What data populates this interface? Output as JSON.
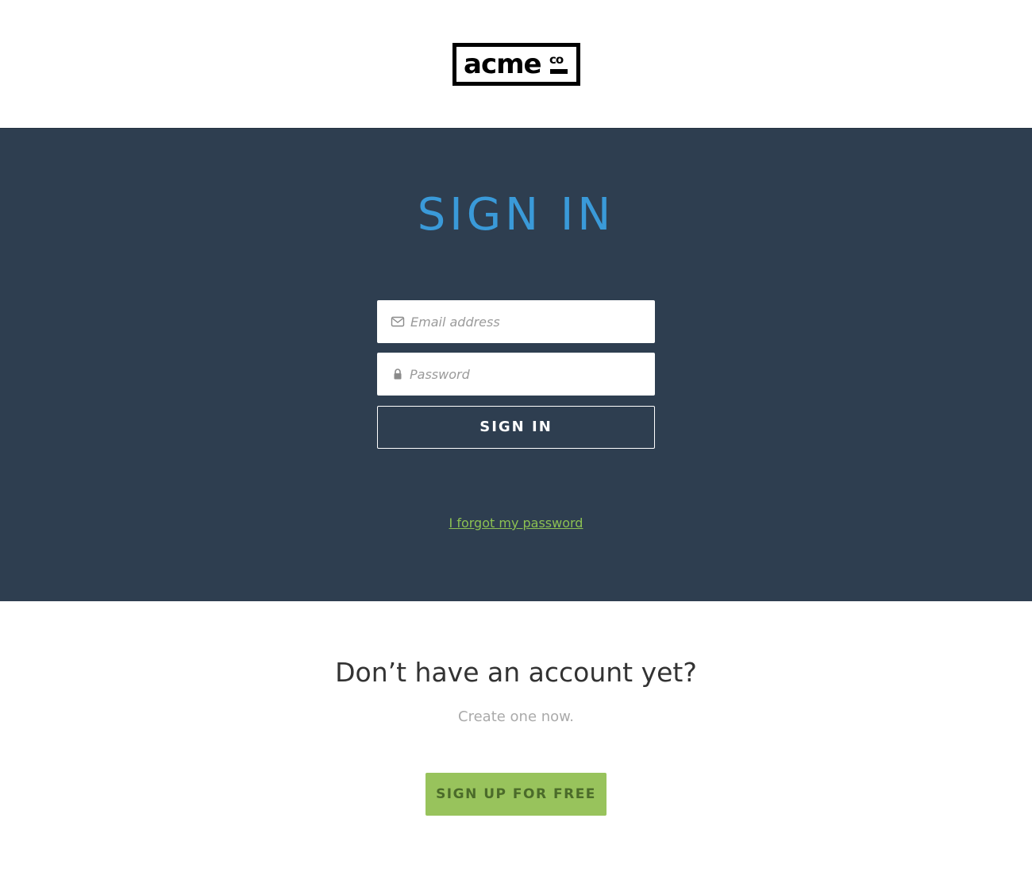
{
  "logo": {
    "main": "acme",
    "sub": "co"
  },
  "signin": {
    "title": "SIGN IN",
    "email_placeholder": "Email address",
    "password_placeholder": "Password",
    "button_label": "SIGN IN",
    "forgot_link": "I forgot my password"
  },
  "signup": {
    "title": "Don’t have an account yet?",
    "subtitle": "Create one now.",
    "button_label": "SIGN UP FOR FREE"
  },
  "icons": {
    "email": "envelope-icon",
    "password": "lock-icon"
  },
  "colors": {
    "panel_background": "#2e3e50",
    "title_accent": "#3a9ad9",
    "link": "#8cc152",
    "signup_button": "#98c35c"
  }
}
